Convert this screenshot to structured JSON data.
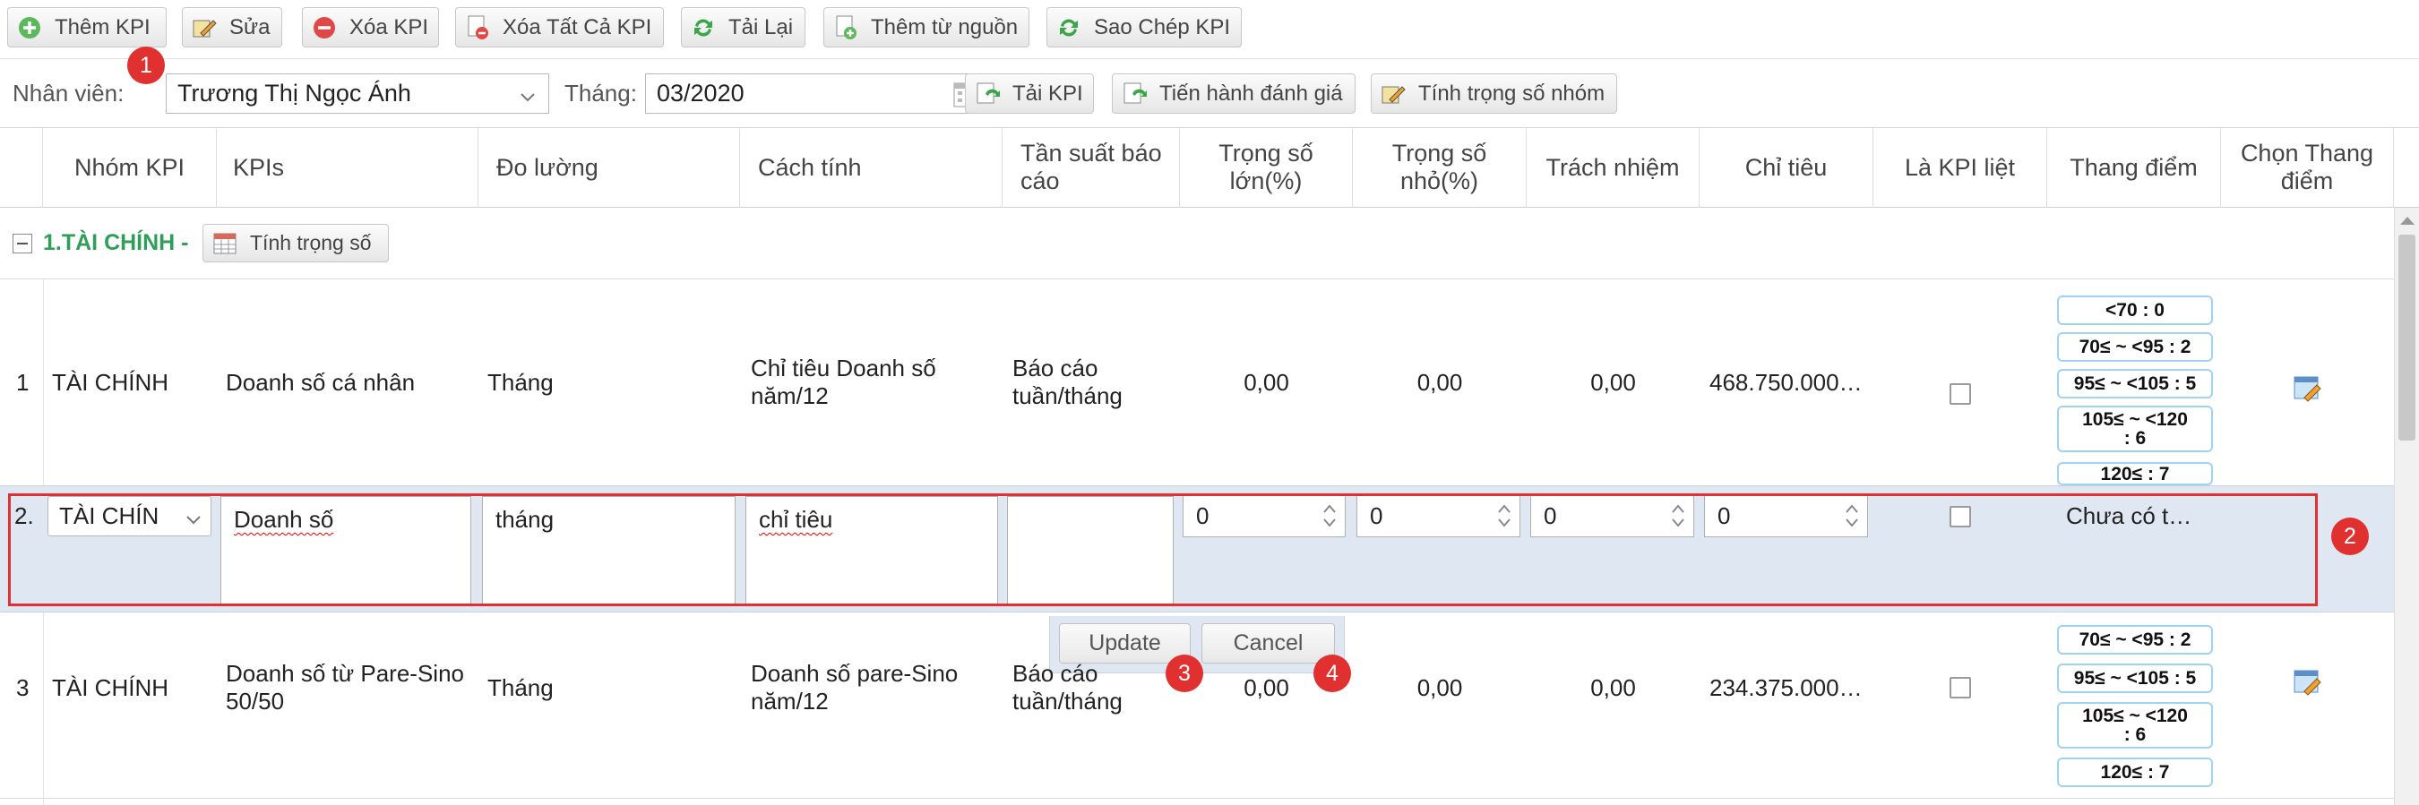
{
  "toolbar": {
    "add_kpi": "Thêm KPI",
    "edit": "Sửa",
    "delete_kpi": "Xóa KPI",
    "delete_all_kpi": "Xóa Tất Cả KPI",
    "reload": "Tải Lại",
    "add_from_source": "Thêm từ nguồn",
    "copy_kpi": "Sao Chép KPI"
  },
  "filter": {
    "employee_label": "Nhân viên:",
    "employee_value": "Trương Thị Ngọc Ánh",
    "month_label": "Tháng:",
    "month_value": "03/2020",
    "load_kpi": "Tải KPI",
    "evaluate": "Tiến hành đánh giá",
    "group_weight": "Tính trọng số nhóm"
  },
  "grid": {
    "columns": [
      "Nhóm KPI",
      "KPIs",
      "Đo lường",
      "Cách tính",
      "Tần suất báo cáo",
      "Trọng số lớn(%)",
      "Trọng số nhỏ(%)",
      "Trách nhiệm",
      "Chỉ tiêu",
      "Là KPI liệt",
      "Thang điểm",
      "Chọn Thang điểm"
    ],
    "group": {
      "title": "1.TÀI CHÍNH -",
      "button": "Tính trọng số"
    },
    "rows": [
      {
        "no": "1",
        "group": "TÀI CHÍNH",
        "kpi": "Doanh số cá nhân",
        "measure": "Tháng",
        "calc": "Chỉ tiêu Doanh số năm/12",
        "freq": "Báo cáo tuần/tháng",
        "w_big": "0,00",
        "w_small": "0,00",
        "resp": "0,00",
        "target": "468.750.000…",
        "scale": [
          "<70 : 0",
          "70≤ ~ <95 : 2",
          "95≤ ~ <105 : 5",
          "105≤ ~ <120 : 6",
          "120≤ : 7"
        ]
      },
      {
        "no": "3",
        "group": "TÀI CHÍNH",
        "kpi": "Doanh số từ Pare-Sino 50/50",
        "measure": "Tháng",
        "calc": "Doanh số pare-Sino năm/12",
        "freq": "Báo cáo tuần/tháng",
        "w_big": "0,00",
        "w_small": "0,00",
        "resp": "0,00",
        "target": "234.375.000…",
        "scale": [
          "70≤ ~ <95 : 2",
          "95≤ ~ <105 : 5",
          "105≤ ~ <120 : 6",
          "120≤ : 7"
        ]
      }
    ],
    "edit_row": {
      "no": "2.",
      "group": "TÀI CHÍN",
      "kpi": "Doanh số",
      "measure": "tháng",
      "calc": "chỉ tiêu",
      "freq": "",
      "w_big": "0",
      "w_small": "0",
      "resp": "0",
      "target": "0",
      "scale": "Chưa có t…",
      "update": "Update",
      "cancel": "Cancel"
    }
  },
  "markers": [
    "1",
    "2",
    "3",
    "4"
  ],
  "colors": {
    "group_green": "#2e9e58",
    "marker_red": "#e03030",
    "edit_row_bg": "#dfe8f2",
    "scale_border": "#9fd3f0"
  }
}
